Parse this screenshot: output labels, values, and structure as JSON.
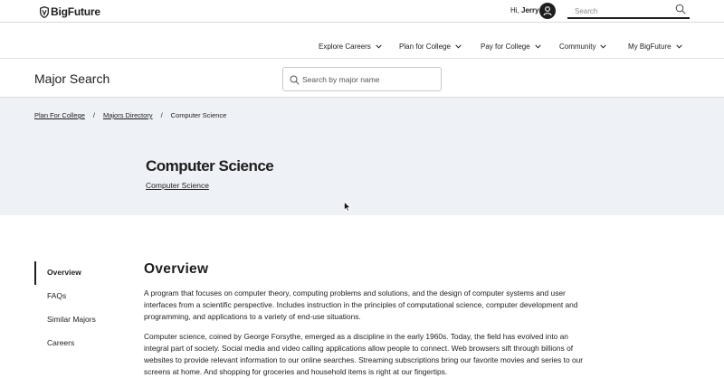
{
  "header": {
    "logo_text": "BigFuture",
    "greeting_prefix": "Hi,",
    "user_name": "Jerry",
    "search_placeholder": "Search"
  },
  "nav": {
    "items": [
      {
        "label": "Explore Careers"
      },
      {
        "label": "Plan for College"
      },
      {
        "label": "Pay for College"
      },
      {
        "label": "Community"
      },
      {
        "label": "My BigFuture"
      }
    ]
  },
  "major_search": {
    "title": "Major Search",
    "placeholder": "Search by major name"
  },
  "breadcrumb": {
    "items": [
      "Plan For College",
      "Majors Directory",
      "Computer Science"
    ],
    "separator": "/"
  },
  "hero": {
    "title": "Computer Science",
    "link_text": "Computer Science"
  },
  "side_nav": {
    "items": [
      {
        "label": "Overview",
        "active": true
      },
      {
        "label": "FAQs"
      },
      {
        "label": "Similar Majors"
      },
      {
        "label": "Careers"
      }
    ]
  },
  "overview": {
    "heading": "Overview",
    "paragraph_1": "A program that focuses on computer theory, computing problems and solutions, and the design of computer systems and user interfaces from a scientific perspective. Includes instruction in the principles of computational science, computer development and programming, and applications to a variety of end-use situations.",
    "paragraph_2": "Computer science, coined by George Forsythe, emerged as a discipline in the early 1960s. Today, the field has evolved into an integral part of society. Social media and video calling applications allow people to connect. Web browsers sift through billions of websites to provide relevant information to our online searches. Streaming subscriptions bring our favorite movies and series to our screens at home. And shopping for groceries and household items is right at our fingertips."
  },
  "colors": {
    "text": "#1e1e1e",
    "hero_bg": "#eef1f6",
    "border": "#d9d9d9"
  }
}
